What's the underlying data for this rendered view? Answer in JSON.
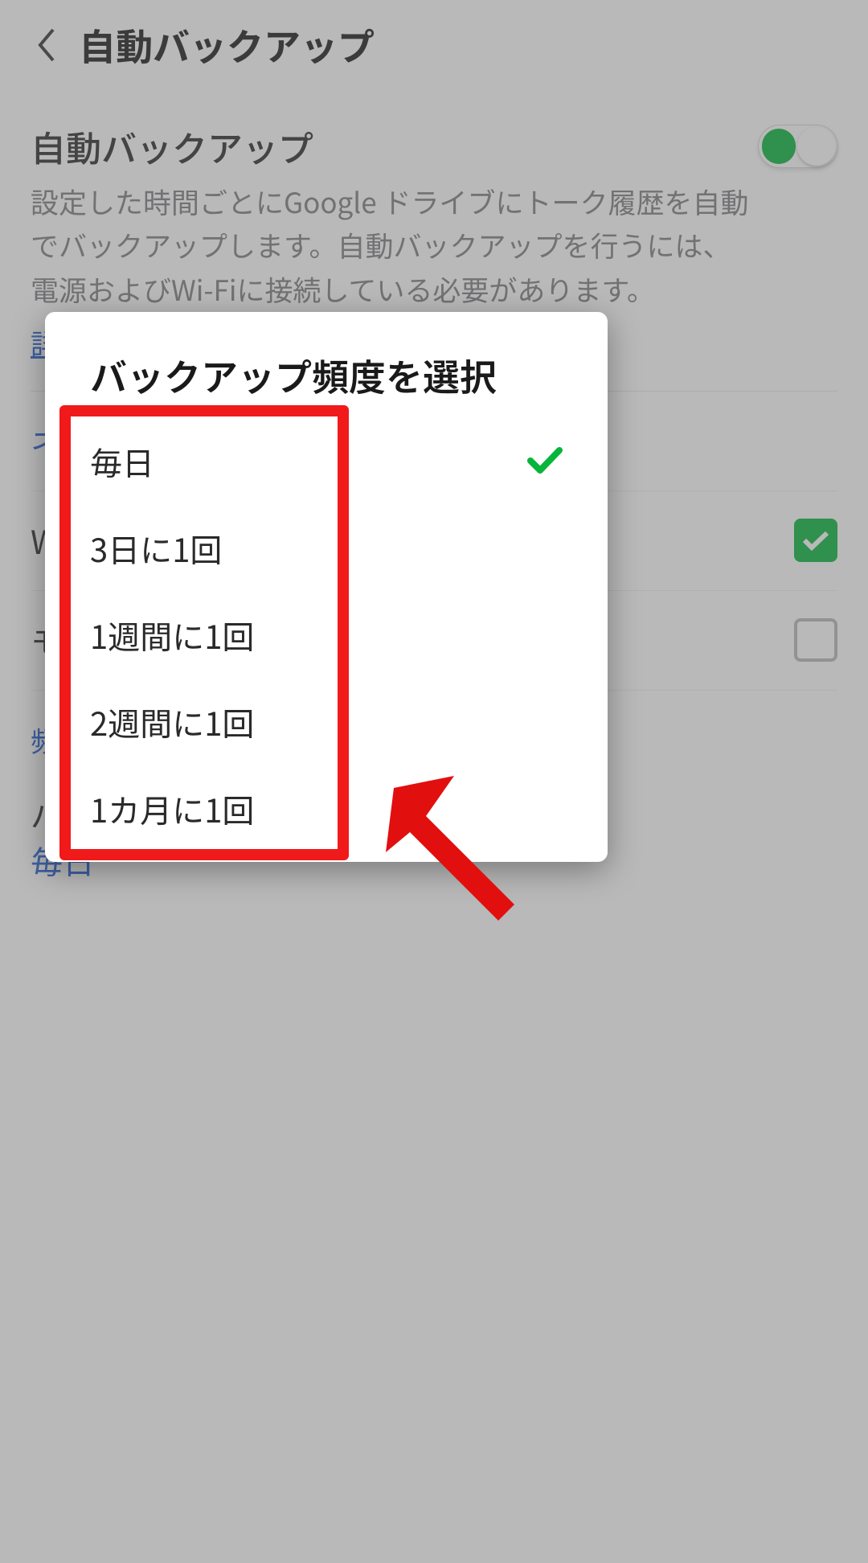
{
  "header": {
    "title": "自動バックアップ"
  },
  "auto_backup": {
    "title": "自動バックアップ",
    "description": "設定した時間ごとにGoogle ドライブにトーク履歴を自動でバックアップします。自動バックアップを行うには、電源およびWi-Fiに接続している必要があります。",
    "details_link": "詳",
    "enabled": true
  },
  "rows": {
    "network_label": "ネ",
    "wifi_label": "W",
    "mobile_label": "モ",
    "frequency_label_short": "頻",
    "backup_row_label": "バ",
    "current_frequency": "毎日"
  },
  "dialog": {
    "title": "バックアップ頻度を選択",
    "options": [
      {
        "label": "毎日",
        "selected": true
      },
      {
        "label": "3日に1回",
        "selected": false
      },
      {
        "label": "1週間に1回",
        "selected": false
      },
      {
        "label": "2週間に1回",
        "selected": false
      },
      {
        "label": "1カ月に1回",
        "selected": false
      }
    ]
  }
}
